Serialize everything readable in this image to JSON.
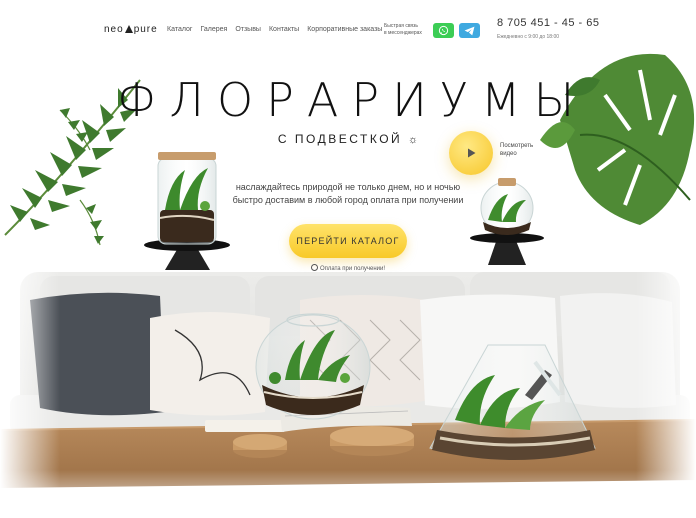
{
  "header": {
    "logo_left": "neo",
    "logo_right": "pure",
    "nav": [
      "Каталог",
      "Галерея",
      "Отзывы",
      "Контакты",
      "Корпоративные заказы"
    ],
    "quick_contact_line1": "Быстрая связь",
    "quick_contact_line2": "в мессенджерах",
    "whatsapp_icon": "whatsapp-icon",
    "telegram_icon": "telegram-icon",
    "phone": "8 705 451 - 45 - 65",
    "hours": "Ежедневно с 9:00 до 18:00"
  },
  "hero": {
    "title": "ФЛОРАРИУМЫ",
    "subtitle": "С ПОДВЕСТКОЙ",
    "subtitle_icon": "☼",
    "desc_line1": "наслаждайтесь природой не только днем, но и ночью",
    "desc_line2": "быстро доставим в любой город оплата при получении",
    "cta_label": "ПЕРЕЙТИ КАТАЛОГ",
    "pay_note": "Оплата при получении!",
    "video_line1": "Посмотреть",
    "video_line2": "видео"
  },
  "colors": {
    "accent_yellow": "#f8c928",
    "whatsapp": "#3ccd55",
    "telegram": "#3fa9e0"
  }
}
